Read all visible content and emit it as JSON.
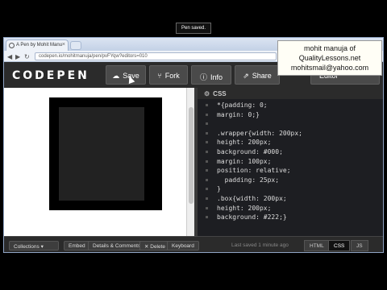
{
  "browser": {
    "tab_title": "A Pen by Mohit Manu",
    "tab_close": "×",
    "url": "codepen.io/mohitmanuja/pen/pvFYqw?editors=010",
    "back": "◀",
    "forward": "▶",
    "reload": "↻"
  },
  "header": {
    "logo": "CODEPEN",
    "save_label": "Save",
    "fork_label": "Fork",
    "info_label": "Info",
    "share_label": "Share",
    "editor_label": "Editor",
    "save_icon": "cloud-icon",
    "fork_icon": "fork-icon",
    "info_icon": "info-icon",
    "share_icon": "share-icon"
  },
  "toast": "Pen saved.",
  "editor": {
    "title": "CSS",
    "lines": [
      "*{padding: 0;",
      "margin: 0;}",
      "",
      ".wrapper{width: 200px;",
      "height: 200px;",
      "background: #000;",
      "margin: 100px;",
      "position: relative;",
      "  padding: 25px;",
      "}",
      ".box{width: 200px;",
      "height: 200px;",
      "background: #222;}"
    ]
  },
  "bottom": {
    "collections": "Collections ▾",
    "embed": "Embed",
    "details": "Details & Comments",
    "delete": "✕ Delete",
    "keyboard": "Keyboard",
    "status": "Last saved 1 minute ago",
    "tab_html": "HTML",
    "tab_css": "CSS",
    "tab_js": "JS"
  },
  "note": {
    "line1": "mohit manuja of",
    "line2": "QualityLessons.net",
    "line3": "mohitsmail@yahoo.com"
  }
}
